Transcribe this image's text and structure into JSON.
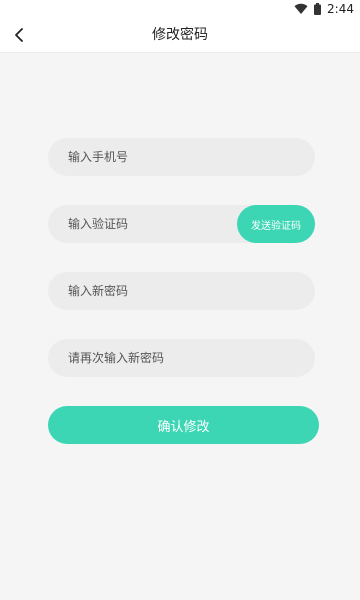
{
  "status_bar": {
    "time": "2:44",
    "icons": [
      "wifi-icon",
      "battery-icon"
    ]
  },
  "header": {
    "back_icon": "chevron-left-icon",
    "title": "修改密码"
  },
  "form": {
    "phone_placeholder": "输入手机号",
    "code_placeholder": "输入验证码",
    "send_code_label": "发送验证码",
    "new_password_placeholder": "输入新密码",
    "confirm_password_placeholder": "请再次输入新密码",
    "submit_label": "确认修改"
  },
  "colors": {
    "accent": "#3dd6b5",
    "background": "#f5f5f5",
    "field_background": "#ececec"
  }
}
